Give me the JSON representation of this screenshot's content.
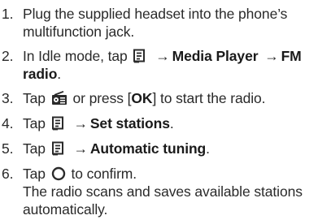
{
  "steps": [
    {
      "number": "1.",
      "text": "Plug the supplied headset into the phone’s multifunction jack."
    },
    {
      "number": "2.",
      "before": "In Idle mode, tap",
      "icon": "menu-icon",
      "arrow1": "→",
      "target1": "Media Player",
      "arrow2": "→",
      "target2": "FM radio",
      "after": "."
    },
    {
      "number": "3.",
      "before": "Tap",
      "icon": "radio-icon",
      "middle": "or press [",
      "key": "OK",
      "after": "] to start the radio."
    },
    {
      "number": "4.",
      "before": "Tap",
      "icon": "menu-icon",
      "arrow": "→",
      "target": "Set stations",
      "after": "."
    },
    {
      "number": "5.",
      "before": "Tap",
      "icon": "menu-icon",
      "arrow": "→",
      "target": "Automatic tuning",
      "after": "."
    },
    {
      "number": "6.",
      "before": "Tap",
      "icon": "confirm-circle-icon",
      "after": "to confirm.",
      "note": "The radio scans and saves available stations automatically."
    }
  ]
}
